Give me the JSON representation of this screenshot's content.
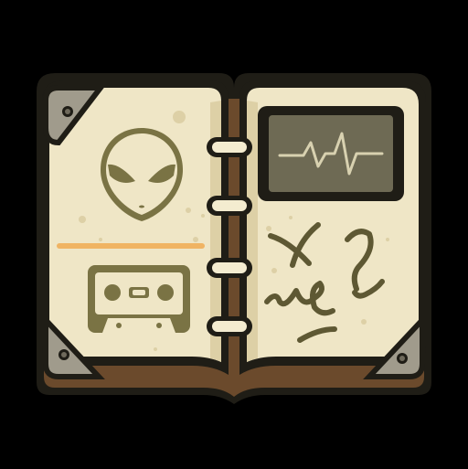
{
  "icon": {
    "name": "notebook-journal-icon",
    "left_page": {
      "items": [
        "alien-head-icon",
        "highlight-line",
        "cassette-tape-icon"
      ]
    },
    "right_page": {
      "items": [
        "waveform-monitor-icon",
        "scribbled-symbols"
      ]
    },
    "binding": {
      "ring_count": 4
    }
  },
  "colors": {
    "background": "#000000",
    "outline": "#1f1d16",
    "cover": "#6b4a2c",
    "page": "#efe6c6",
    "page_shadow": "#ddd0a6",
    "ink": "#7a7344",
    "ink_dark": "#5e5833",
    "corner_metal": "#a09b8c",
    "corner_metal_dark": "#6f6a5c",
    "ring_fill": "#f4ecd0",
    "screen_bezel": "#3a382c",
    "screen": "#6e6a54",
    "wave": "#d8d1b0",
    "highlight": "#f0b463"
  }
}
